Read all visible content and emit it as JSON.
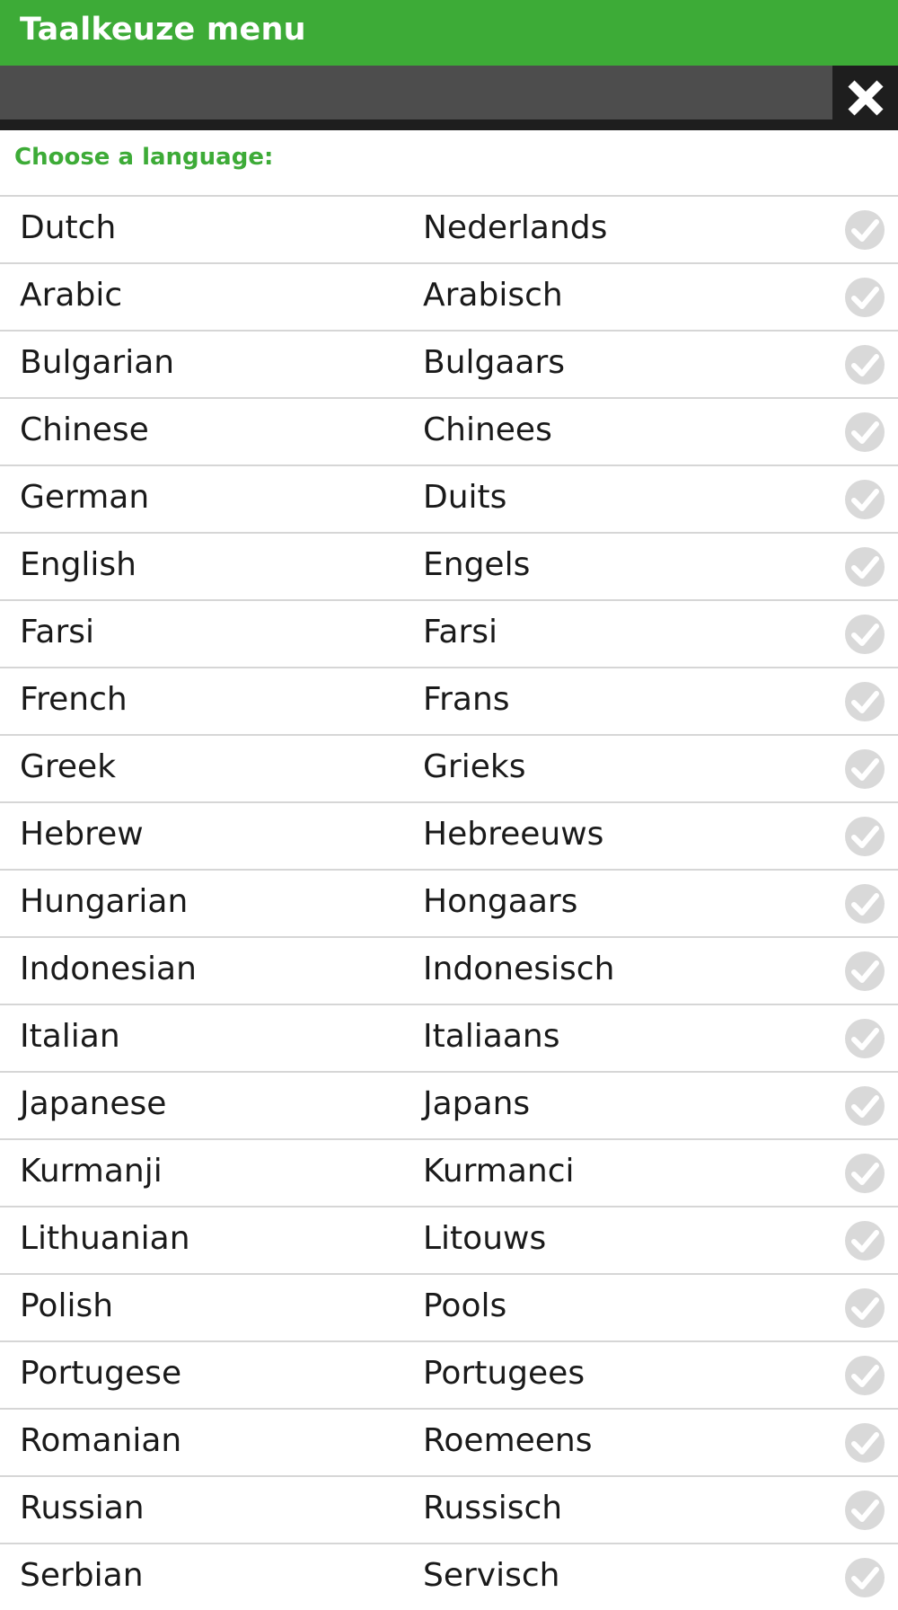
{
  "header": {
    "title": "Taalkeuze menu",
    "color": "#3dab37"
  },
  "search": {
    "value": "",
    "placeholder": ""
  },
  "close_icon": "close-icon",
  "prompt": "Choose a language:",
  "languages": [
    {
      "en": "Dutch",
      "nl": "Nederlands"
    },
    {
      "en": "Arabic",
      "nl": "Arabisch"
    },
    {
      "en": "Bulgarian",
      "nl": "Bulgaars"
    },
    {
      "en": "Chinese",
      "nl": "Chinees"
    },
    {
      "en": "German",
      "nl": "Duits"
    },
    {
      "en": "English",
      "nl": "Engels"
    },
    {
      "en": "Farsi",
      "nl": "Farsi"
    },
    {
      "en": "French",
      "nl": "Frans"
    },
    {
      "en": "Greek",
      "nl": "Grieks"
    },
    {
      "en": "Hebrew",
      "nl": "Hebreeuws"
    },
    {
      "en": "Hungarian",
      "nl": "Hongaars"
    },
    {
      "en": "Indonesian",
      "nl": "Indonesisch"
    },
    {
      "en": "Italian",
      "nl": "Italiaans"
    },
    {
      "en": "Japanese",
      "nl": "Japans"
    },
    {
      "en": "Kurmanji",
      "nl": "Kurmanci"
    },
    {
      "en": "Lithuanian",
      "nl": "Litouws"
    },
    {
      "en": "Polish",
      "nl": "Pools"
    },
    {
      "en": "Portugese",
      "nl": "Portugees"
    },
    {
      "en": "Romanian",
      "nl": "Roemeens"
    },
    {
      "en": "Russian",
      "nl": "Russisch"
    },
    {
      "en": "Serbian",
      "nl": "Servisch"
    }
  ],
  "check_icon": "check-circle-icon",
  "check_color": "#d9d9d9"
}
